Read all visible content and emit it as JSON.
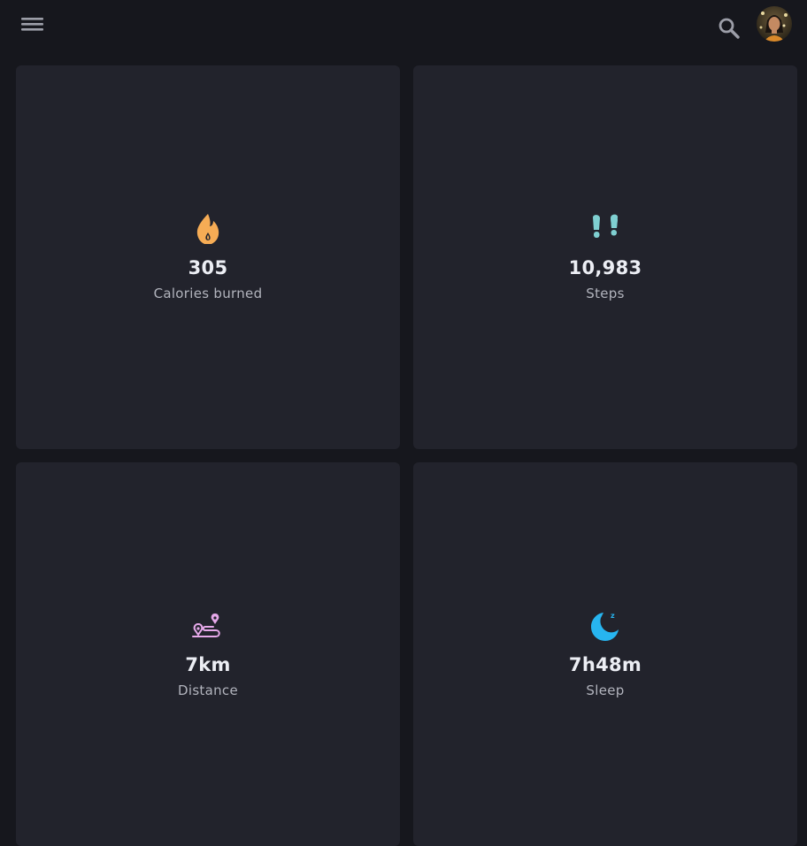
{
  "header": {
    "menu_icon": "hamburger-menu-icon",
    "search_icon": "search-icon",
    "avatar": "user-avatar"
  },
  "stats": [
    {
      "icon": "flame-icon",
      "value": "305",
      "label": "Calories burned",
      "color": "#f6ac55"
    },
    {
      "icon": "footprints-icon",
      "value": "10,983",
      "label": "Steps",
      "color": "#7fcfd1"
    },
    {
      "icon": "route-icon",
      "value": "7km",
      "label": "Distance",
      "color": "#e6a9ea"
    },
    {
      "icon": "moon-sleep-icon",
      "value": "7h48m",
      "label": "Sleep",
      "color": "#27b5f0"
    }
  ],
  "colors": {
    "background": "#16171d",
    "card": "#22232c",
    "text_primary": "#eceef4",
    "text_secondary": "#b2b4bd"
  }
}
